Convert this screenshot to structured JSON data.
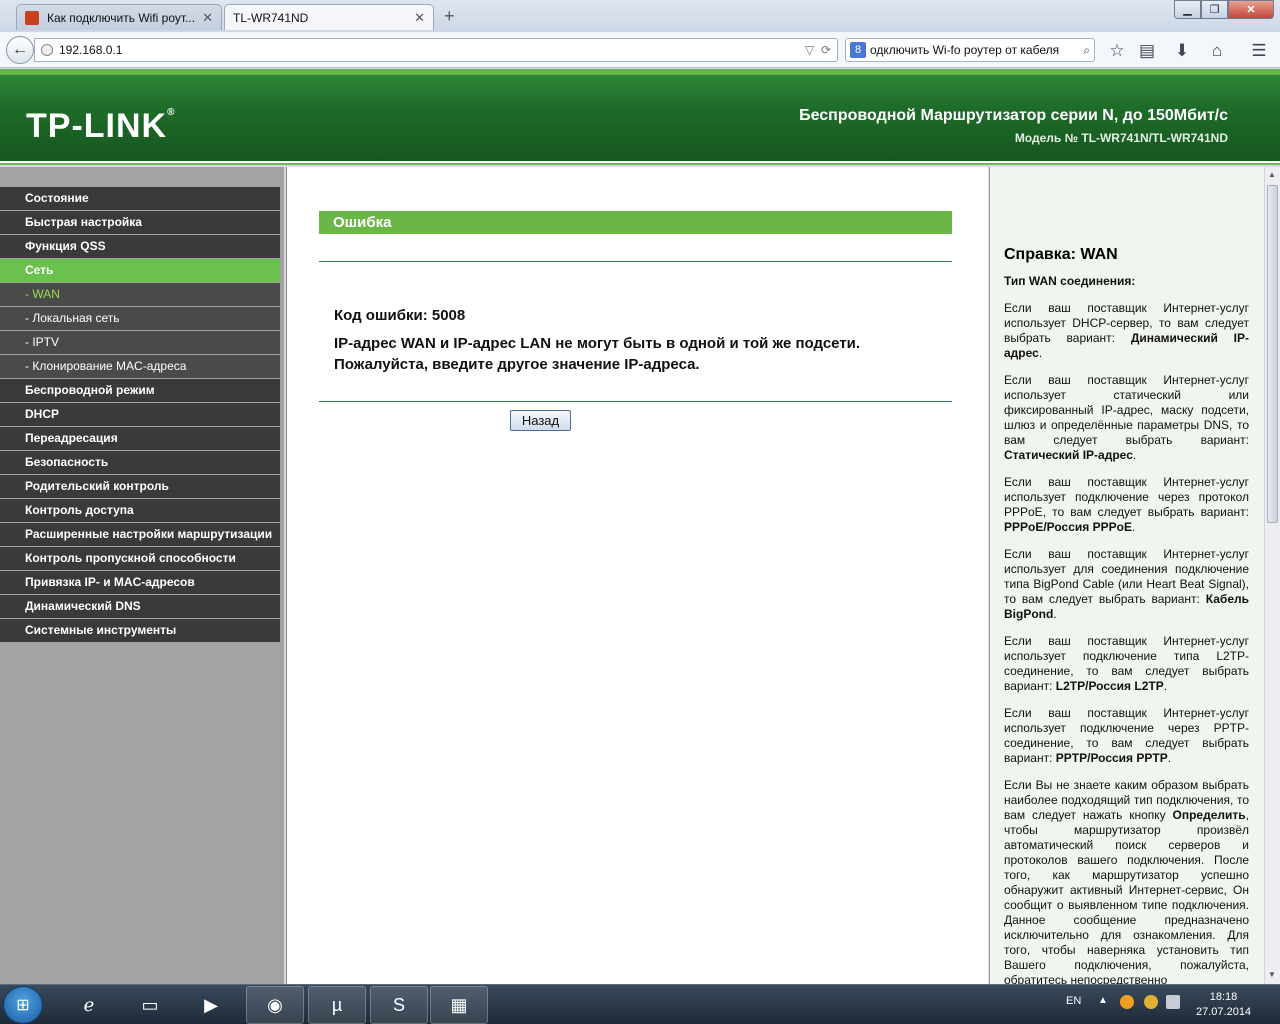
{
  "browser": {
    "tabs": [
      {
        "title": "Как подключить Wifi роут..."
      },
      {
        "title": "TL-WR741ND"
      }
    ],
    "new_tab": "+",
    "url": "192.168.0.1",
    "search_text": "одключить Wi-fo роутер от кабеля",
    "search_engine_badge": "8"
  },
  "router": {
    "logo": "TP-LINK",
    "product_title": "Беспроводной Маршрутизатор серии N, до 150Мбит/с",
    "model": "Модель № TL-WR741N/TL-WR741ND"
  },
  "menu": [
    {
      "label": "Состояние"
    },
    {
      "label": "Быстрая настройка"
    },
    {
      "label": "Функция QSS"
    },
    {
      "label": "Сеть"
    },
    {
      "label": "- WAN"
    },
    {
      "label": "- Локальная сеть"
    },
    {
      "label": "- IPTV"
    },
    {
      "label": "- Клонирование MAC-адреса"
    },
    {
      "label": "Беспроводной режим"
    },
    {
      "label": "DHCP"
    },
    {
      "label": "Переадресация"
    },
    {
      "label": "Безопасность"
    },
    {
      "label": "Родительский контроль"
    },
    {
      "label": "Контроль доступа"
    },
    {
      "label": "Расширенные настройки маршрутизации"
    },
    {
      "label": "Контроль пропускной способности"
    },
    {
      "label": "Привязка IP- и MAC-адресов"
    },
    {
      "label": "Динамический DNS"
    },
    {
      "label": "Системные инструменты"
    }
  ],
  "error": {
    "title": "Ошибка",
    "code_line": "Код ошибки: 5008",
    "message_line1": "IP-адрес WAN и IP-адрес LAN не могут быть в одной и той же подсети.",
    "message_line2": "Пожалуйста, введите другое значение IP-адреса.",
    "back_label": "Назад"
  },
  "help": {
    "title": "Справка: WAN",
    "subtitle": "Тип WAN соединения:",
    "p1_text": "Если ваш поставщик Интернет-услуг использует DHCP-сервер, то вам следует выбрать вариант: ",
    "p1_bold": "Динамический IP-адрес",
    "p2_text": "Если ваш поставщик Интернет-услуг использует статический или фиксированный IP-адрес, маску подсети, шлюз и определённые параметры DNS, то вам следует выбрать вариант: ",
    "p2_bold": "Статический IP-адрес",
    "p3_text": "Если ваш поставщик Интернет-услуг использует подключение через протокол PPPoE, то вам следует выбрать вариант: ",
    "p3_bold": "PPPoE/Россия PPPoE",
    "p4_text": "Если ваш поставщик Интернет-услуг использует для соединения подключение типа BigPond Cable (или Heart Beat Signal), то вам следует выбрать вариант: ",
    "p4_bold": "Кабель BigPond",
    "p5_text": "Если ваш поставщик Интернет-услуг использует подключение типа L2TP-соединение, то вам следует выбрать вариант: ",
    "p5_bold": "L2TP/Россия L2TP",
    "p6_text": "Если ваш поставщик Интернет-услуг использует подключение через PPTP-соединение, то вам следует выбрать вариант: ",
    "p6_bold": "PPTP/Россия PPTP",
    "p7_a": "Если Вы не знаете каким образом выбрать наиболее подходящий тип подключения, то вам следует нажать кнопку ",
    "p7_bold": "Определить",
    "p7_b": ", чтобы маршрутизатор произвёл автоматический поиск серверов и протоколов вашего подключения. После того, как маршрутизатор успешно обнаружит активный Интернет-сервис, Он сообщит о выявленном типе подключения. Данное сообщение предназначено исключительно для ознакомления. Для того, чтобы наверняка установить тип Вашего подключения, пожалуйста, обратитесь непосредственно"
  },
  "taskbar": {
    "lang": "EN",
    "time": "18:18",
    "date": "27.07.2014"
  }
}
